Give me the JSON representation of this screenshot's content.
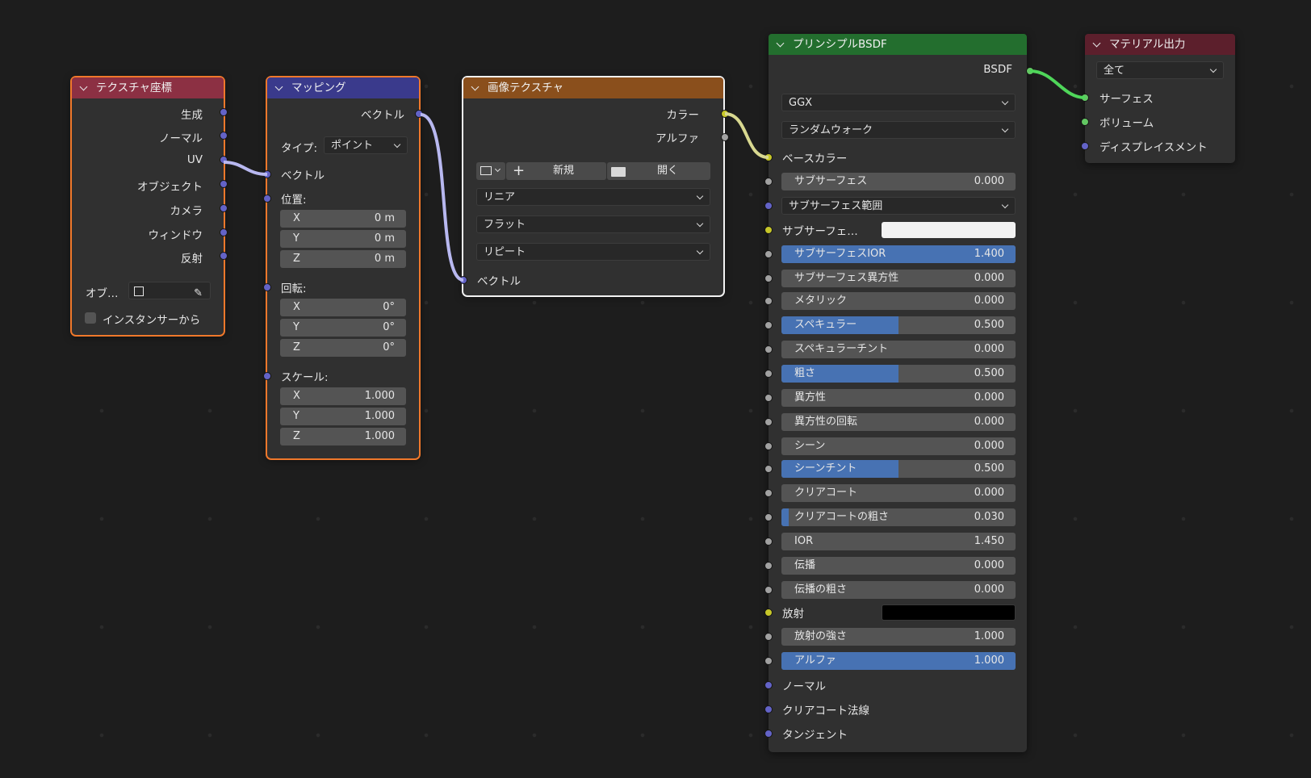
{
  "colors": {
    "tex_coord_header": "#8c3043",
    "mapping_header": "#3a3a8c",
    "image_tex_header": "#8a4f1c",
    "bsdf_header": "#236e2e",
    "output_header": "#5c1f2c",
    "link_vector": "#b8b8f0",
    "link_color": "#d8d890",
    "link_shader": "#4fd65a",
    "socket_vector": "#6363c7",
    "socket_color": "#c7c729",
    "socket_float": "#a1a1a1",
    "socket_shader": "#63c763",
    "field_fill": "#4772b3",
    "subsurface_color": "#f2f2f2",
    "emission_color": "#000000"
  },
  "tex_coord": {
    "title": "テクスチャ座標",
    "outputs": [
      "生成",
      "ノーマル",
      "UV",
      "オブジェクト",
      "カメラ",
      "ウィンドウ",
      "反射"
    ],
    "object_label": "オブ…",
    "instancer_label": "インスタンサーから",
    "icons": [
      "object-icon",
      "eyedropper-icon"
    ]
  },
  "mapping": {
    "title": "マッピング",
    "output": "ベクトル",
    "type_label": "タイプ:",
    "type_value": "ポイント",
    "vector_input": "ベクトル",
    "location_label": "位置:",
    "location": [
      {
        "axis": "X",
        "value": "0 m"
      },
      {
        "axis": "Y",
        "value": "0 m"
      },
      {
        "axis": "Z",
        "value": "0 m"
      }
    ],
    "rotation_label": "回転:",
    "rotation": [
      {
        "axis": "X",
        "value": "0°"
      },
      {
        "axis": "Y",
        "value": "0°"
      },
      {
        "axis": "Z",
        "value": "0°"
      }
    ],
    "scale_label": "スケール:",
    "scale": [
      {
        "axis": "X",
        "value": "1.000"
      },
      {
        "axis": "Y",
        "value": "1.000"
      },
      {
        "axis": "Z",
        "value": "1.000"
      }
    ]
  },
  "image_tex": {
    "title": "画像テクスチャ",
    "outputs": [
      "カラー",
      "アルファ"
    ],
    "new_label": "新規",
    "open_label": "開く",
    "interpolation": "リニア",
    "projection": "フラット",
    "extension": "リピート",
    "vector_input": "ベクトル",
    "icons": [
      "image-icon",
      "plus-icon",
      "folder-icon"
    ]
  },
  "bsdf": {
    "title": "プリンシプルBSDF",
    "output": "BSDF",
    "distribution": "GGX",
    "subsurface_method": "ランダムウォーク",
    "base_color_label": "ベースカラー",
    "subsurface_range_value": "サブサーフェス範囲",
    "subsurface_color_label": "サブサーフェ…",
    "emission_label": "放射",
    "props": [
      {
        "label": "サブサーフェス",
        "value": "0.000",
        "fill": 0
      },
      {
        "label": "サブサーフェスIOR",
        "value": "1.400",
        "fill": 1
      },
      {
        "label": "サブサーフェス異方性",
        "value": "0.000",
        "fill": 0
      },
      {
        "label": "メタリック",
        "value": "0.000",
        "fill": 0
      },
      {
        "label": "スペキュラー",
        "value": "0.500",
        "fill": 0.5
      },
      {
        "label": "スペキュラーチント",
        "value": "0.000",
        "fill": 0
      },
      {
        "label": "粗さ",
        "value": "0.500",
        "fill": 0.5
      },
      {
        "label": "異方性",
        "value": "0.000",
        "fill": 0
      },
      {
        "label": "異方性の回転",
        "value": "0.000",
        "fill": 0
      },
      {
        "label": "シーン",
        "value": "0.000",
        "fill": 0
      },
      {
        "label": "シーンチント",
        "value": "0.500",
        "fill": 0.5
      },
      {
        "label": "クリアコート",
        "value": "0.000",
        "fill": 0
      },
      {
        "label": "クリアコートの粗さ",
        "value": "0.030",
        "fill": 0.03
      },
      {
        "label": "IOR",
        "value": "1.450",
        "fill": 0
      },
      {
        "label": "伝播",
        "value": "0.000",
        "fill": 0
      },
      {
        "label": "伝播の粗さ",
        "value": "0.000",
        "fill": 0
      },
      {
        "label": "放射の強さ",
        "value": "1.000",
        "fill": 0
      },
      {
        "label": "アルファ",
        "value": "1.000",
        "fill": 1
      }
    ],
    "vector_inputs": [
      "ノーマル",
      "クリアコート法線",
      "タンジェント"
    ]
  },
  "output": {
    "title": "マテリアル出力",
    "target": "全て",
    "inputs": [
      "サーフェス",
      "ボリューム",
      "ディスプレイスメント"
    ]
  }
}
